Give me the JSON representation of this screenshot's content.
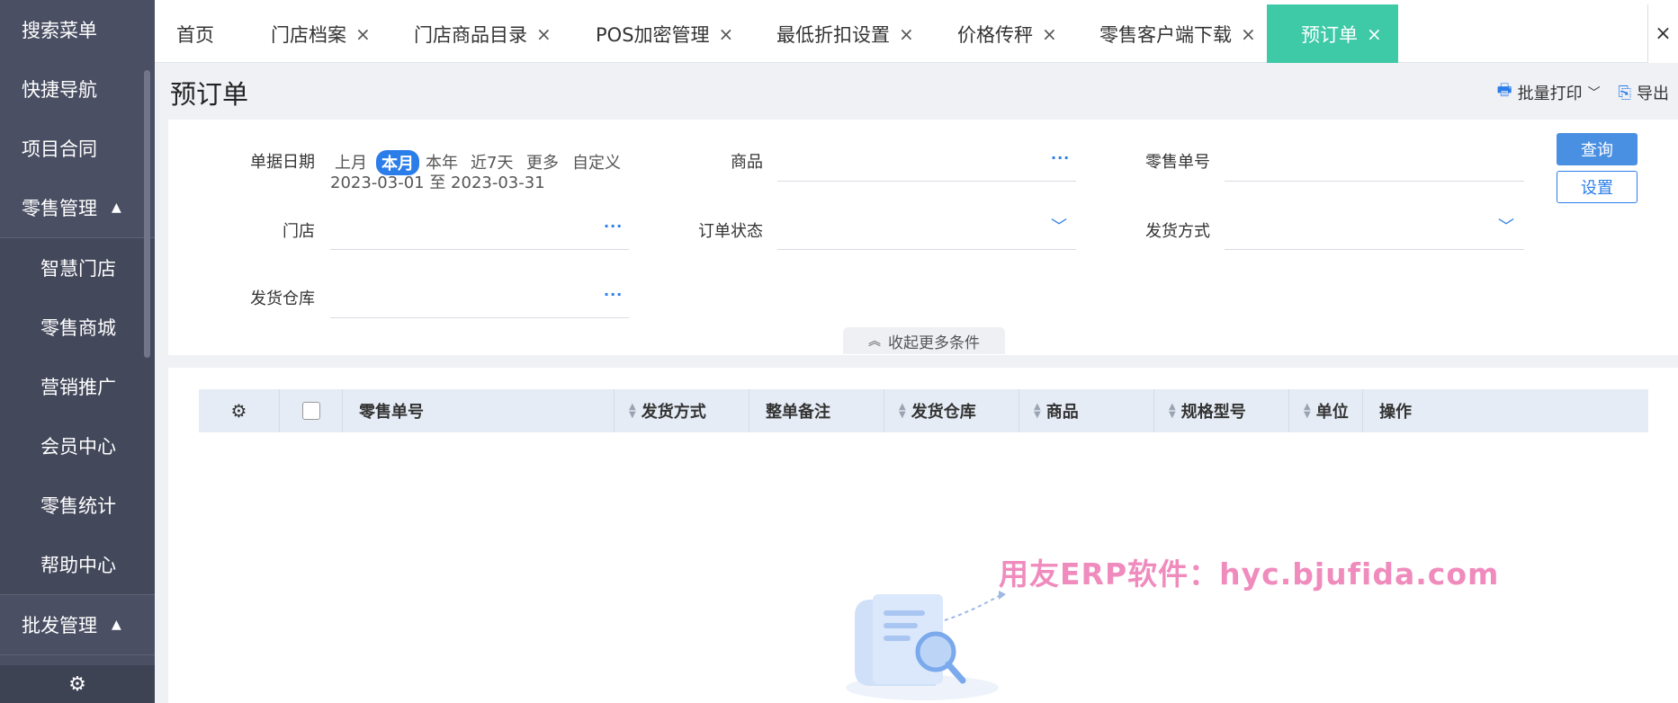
{
  "sidebar": {
    "items": [
      {
        "label": "搜索菜单"
      },
      {
        "label": "快捷导航"
      },
      {
        "label": "项目合同"
      },
      {
        "label": "零售管理",
        "expanded": true
      },
      {
        "label": "智慧门店"
      },
      {
        "label": "零售商城"
      },
      {
        "label": "营销推广"
      },
      {
        "label": "会员中心"
      },
      {
        "label": "零售统计"
      },
      {
        "label": "帮助中心"
      },
      {
        "label": "批发管理",
        "expanded": true
      }
    ],
    "bottom_icon": "gear-icon"
  },
  "tabs": [
    {
      "label": "首页"
    },
    {
      "label": "门店档案"
    },
    {
      "label": "门店商品目录"
    },
    {
      "label": "POS加密管理"
    },
    {
      "label": "最低折扣设置"
    },
    {
      "label": "价格传秤"
    },
    {
      "label": "零售客户端下载"
    },
    {
      "label": "预订单",
      "active": true
    }
  ],
  "page": {
    "title": "预订单",
    "batch_print": "批量打印",
    "export": "导出"
  },
  "filters": {
    "date_label": "单据日期",
    "date_options": [
      "上月",
      "本月",
      "本年",
      "近7天",
      "更多",
      "自定义"
    ],
    "date_selected": "本月",
    "date_range": "2023-03-01 至 2023-03-31",
    "product_label": "商品",
    "retail_no_label": "零售单号",
    "store_label": "门店",
    "order_status_label": "订单状态",
    "shipping_label": "发货方式",
    "warehouse_label": "发货仓库",
    "query_button": "查询",
    "settings_button": "设置",
    "collapse_label": "收起更多条件"
  },
  "table": {
    "columns": [
      "零售单号",
      "发货方式",
      "整单备注",
      "发货仓库",
      "商品",
      "规格型号",
      "单位",
      "操作"
    ]
  },
  "watermark": "用友ERP软件：hyc.bjufida.com",
  "colors": {
    "sidebar_bg": "#4a4f63",
    "active_tab": "#3ec9a7",
    "primary": "#2b7de9",
    "watermark": "#f08bbd"
  }
}
